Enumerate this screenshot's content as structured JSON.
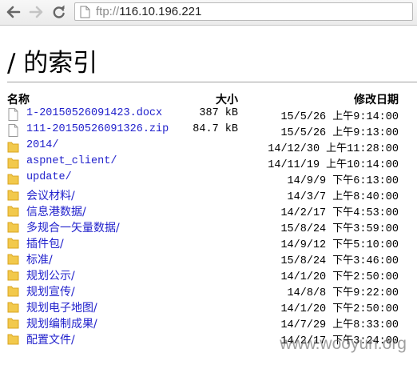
{
  "browser": {
    "url_scheme": "ftp://",
    "url_host": "116.10.196.221"
  },
  "page": {
    "title": "/ 的索引",
    "headers": {
      "name": "名称",
      "size": "大小",
      "modified": "修改日期"
    }
  },
  "listing": [
    {
      "type": "file",
      "name": "1-20150526091423.docx",
      "size": "387 kB",
      "date": "15/5/26",
      "ampm": "上午",
      "time": "9:14:00"
    },
    {
      "type": "file",
      "name": "111-20150526091326.zip",
      "size": "84.7 kB",
      "date": "15/5/26",
      "ampm": "上午",
      "time": "9:13:00"
    },
    {
      "type": "folder",
      "name": "2014/",
      "size": "",
      "date": "14/12/30",
      "ampm": "上午",
      "time": "11:28:00"
    },
    {
      "type": "folder",
      "name": "aspnet_client/",
      "size": "",
      "date": "14/11/19",
      "ampm": "上午",
      "time": "10:14:00"
    },
    {
      "type": "folder",
      "name": "update/",
      "size": "",
      "date": "14/9/9",
      "ampm": "下午",
      "time": "6:13:00"
    },
    {
      "type": "folder",
      "name": "会议材料/",
      "size": "",
      "date": "14/3/7",
      "ampm": "上午",
      "time": "8:40:00"
    },
    {
      "type": "folder",
      "name": "信息港数据/",
      "size": "",
      "date": "14/2/17",
      "ampm": "下午",
      "time": "4:53:00"
    },
    {
      "type": "folder",
      "name": "多规合一矢量数据/",
      "size": "",
      "date": "15/8/24",
      "ampm": "下午",
      "time": "3:59:00"
    },
    {
      "type": "folder",
      "name": "插件包/",
      "size": "",
      "date": "14/9/12",
      "ampm": "下午",
      "time": "5:10:00"
    },
    {
      "type": "folder",
      "name": "标准/",
      "size": "",
      "date": "15/8/24",
      "ampm": "下午",
      "time": "3:46:00"
    },
    {
      "type": "folder",
      "name": "规划公示/",
      "size": "",
      "date": "14/1/20",
      "ampm": "下午",
      "time": "2:50:00"
    },
    {
      "type": "folder",
      "name": "规划宣传/",
      "size": "",
      "date": "14/8/8",
      "ampm": "下午",
      "time": "9:22:00"
    },
    {
      "type": "folder",
      "name": "规划电子地图/",
      "size": "",
      "date": "14/1/20",
      "ampm": "下午",
      "time": "2:50:00"
    },
    {
      "type": "folder",
      "name": "规划编制成果/",
      "size": "",
      "date": "14/7/29",
      "ampm": "上午",
      "time": "8:33:00"
    },
    {
      "type": "folder",
      "name": "配置文件/",
      "size": "",
      "date": "14/2/17",
      "ampm": "下午",
      "time": "3:24:00"
    }
  ],
  "watermark": "www.wooyun.org",
  "icons": {
    "back": "arrow-left-icon",
    "forward": "arrow-right-icon",
    "reload": "reload-icon",
    "page": "page-icon",
    "file": "file-icon",
    "folder": "folder-icon"
  },
  "colors": {
    "link": "#2222cc",
    "folder": "#f2c94c"
  }
}
